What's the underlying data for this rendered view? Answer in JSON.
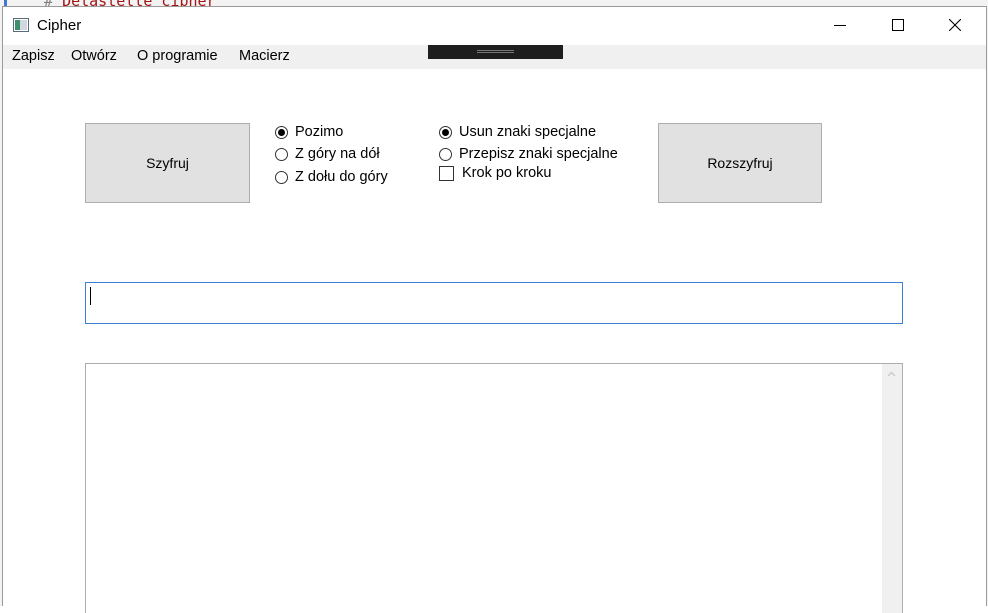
{
  "background": {
    "code_hash": "#",
    "code_text": "Delastelle cipher"
  },
  "window": {
    "title": "Cipher"
  },
  "menu": {
    "items": [
      "Zapisz",
      "Otwórz",
      "O programie",
      "Macierz"
    ]
  },
  "buttons": {
    "encrypt_label": "Szyfruj",
    "decrypt_label": "Rozszyfruj"
  },
  "direction_options": [
    {
      "label": "Pozimo",
      "checked": true
    },
    {
      "label": "Z góry na dół",
      "checked": false
    },
    {
      "label": "Z dołu do góry",
      "checked": false
    }
  ],
  "special_chars_options": [
    {
      "label": "Usun znaki specjalne",
      "checked": true
    },
    {
      "label": "Przepisz znaki specjalne",
      "checked": false
    }
  ],
  "step_by_step": {
    "label": "Krok po kroku",
    "checked": false
  },
  "input": {
    "value": ""
  },
  "output": {
    "value": ""
  },
  "colors": {
    "input_border": "#3c80d4",
    "button_bg": "#e1e1e1"
  }
}
